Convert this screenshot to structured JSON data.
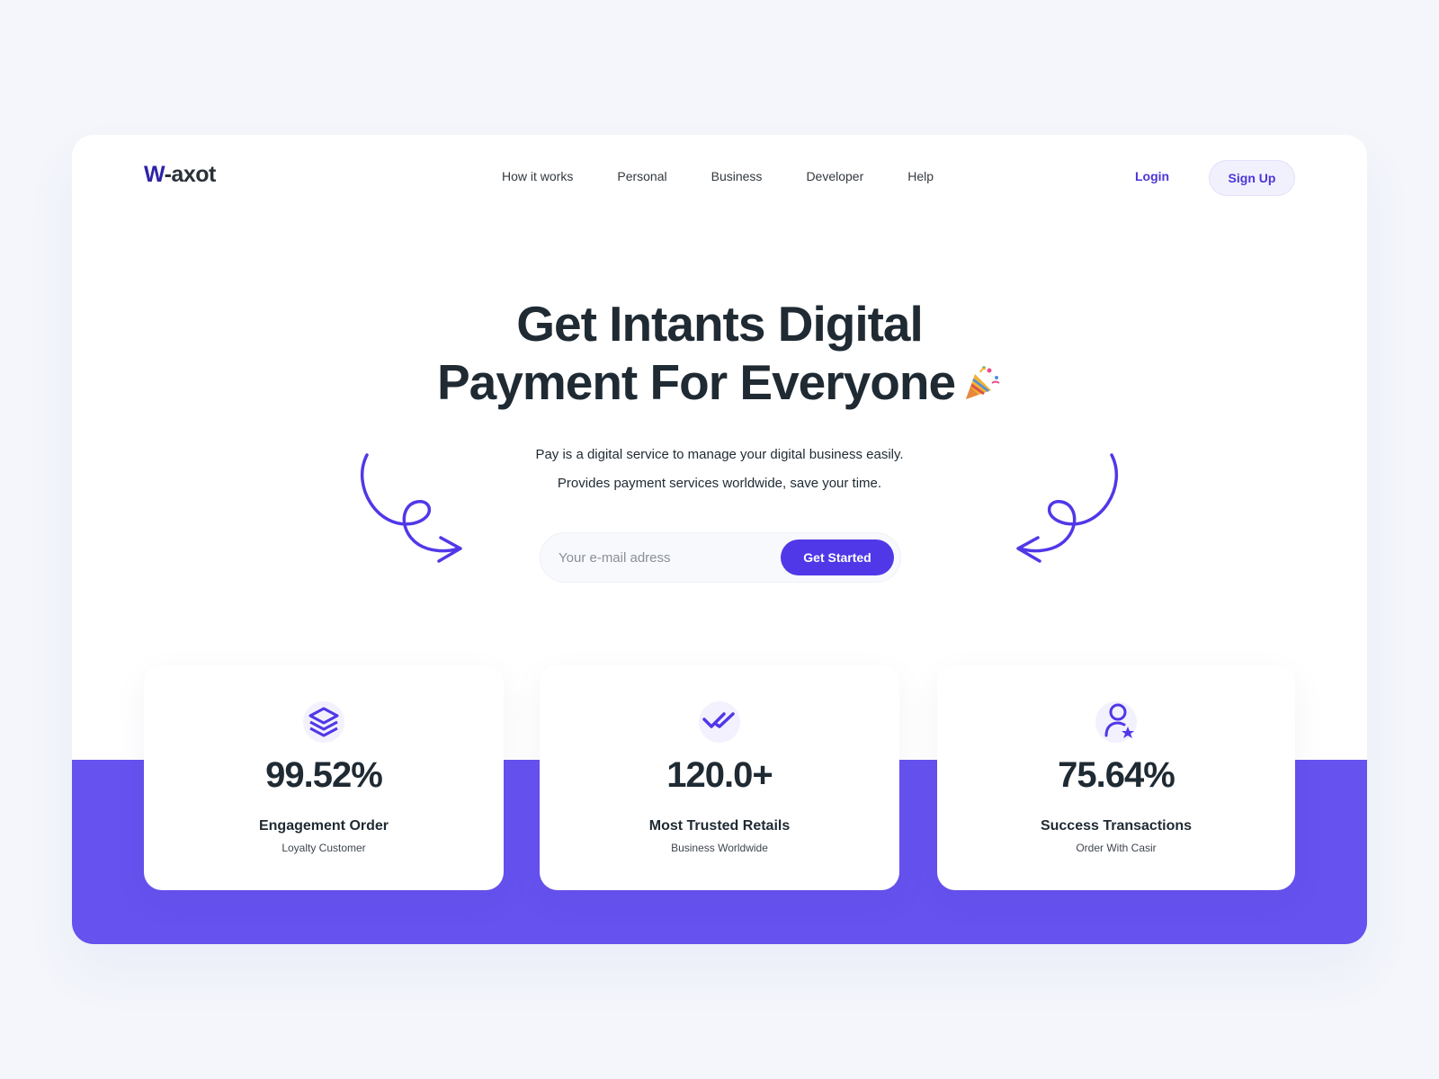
{
  "brand": {
    "mark": "W",
    "rest": "-axot",
    "accent_color": "#4b36d8",
    "band_color": "#6652ef"
  },
  "nav": {
    "items": [
      "How it works",
      "Personal",
      "Business",
      "Developer",
      "Help"
    ],
    "login_label": "Login",
    "signup_label": "Sign Up"
  },
  "hero": {
    "title_line1": "Get Intants Digital",
    "title_line2": "Payment For Everyone",
    "title_icon": "party-popper-icon",
    "sub_line1": "Pay is a digital service to manage your digital business easily.",
    "sub_line2": "Provides payment services worldwide, save your time.",
    "email_placeholder": "Your e-mail adress",
    "cta_label": "Get Started"
  },
  "stats": [
    {
      "icon": "layers-icon",
      "value": "99.52%",
      "label": "Engagement Order",
      "caption": "Loyalty Customer"
    },
    {
      "icon": "double-check-icon",
      "value": "120.0+",
      "label": "Most Trusted Retails",
      "caption": "Business Worldwide"
    },
    {
      "icon": "user-star-icon",
      "value": "75.64%",
      "label": "Success Transactions",
      "caption": "Order With Casir"
    }
  ]
}
